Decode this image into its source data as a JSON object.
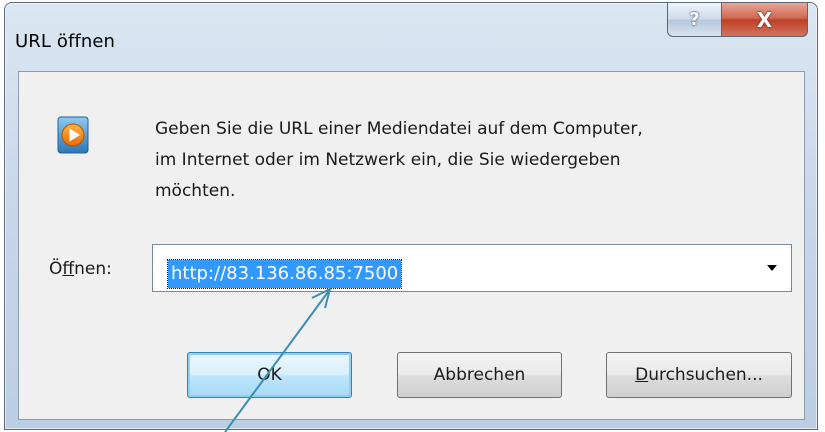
{
  "window": {
    "title": "URL öffnen",
    "help_icon": "help-icon",
    "close_icon": "close-icon",
    "help_glyph": "?",
    "close_glyph": "X"
  },
  "dialog": {
    "app_icon": "media-player-icon",
    "message": "Geben Sie die URL einer Mediendatei auf dem Computer,\nim Internet oder im Netzwerk ein, die Sie wiedergeben\nmöchten.",
    "open_label_prefix": "Ö",
    "open_label_mnemonic": "f",
    "open_label_suffix": "fnen:",
    "url_value": "http://83.136.86.85:7500",
    "dropdown_icon": "chevron-down-icon"
  },
  "buttons": {
    "ok_label": "OK",
    "cancel_label": "Abbrechen",
    "browse_mnemonic": "D",
    "browse_rest": "urchsuchen..."
  },
  "colors": {
    "selection": "#3399ff",
    "annotation_arrow": "#3a8fb0",
    "close_button": "#c7432b"
  }
}
